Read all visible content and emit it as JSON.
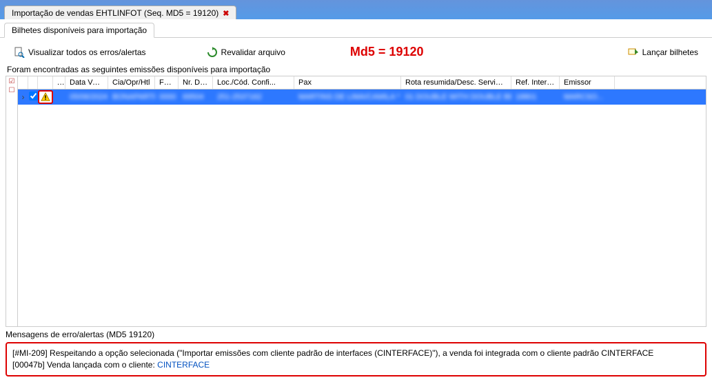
{
  "window": {
    "title": "Importação de vendas EHTLINFOT (Seq. MD5 = 19120)"
  },
  "tabs": {
    "main": "Bilhetes disponíveis para importação"
  },
  "toolbar": {
    "view_errors": "Visualizar todos os erros/alertas",
    "revalidate": "Revalidar arquivo",
    "md5_label": "Md5 = 19120",
    "launch": "Lançar bilhetes"
  },
  "section": {
    "found_label": "Foram encontradas as seguintes emissões disponíveis para importação"
  },
  "grid": {
    "headers": {
      "dots": "...",
      "data_venda": "Data Venda",
      "cia": "Cia/Opr/Htl",
      "form": "Form",
      "nr_doc": "Nr. Doc.",
      "loc": "Loc./Cód. Confi...",
      "pax": "Pax",
      "rota": "Rota resumida/Desc. Serviços",
      "ref": "Ref. Interf...",
      "emissor": "Emissor"
    },
    "row": {
      "checked": true,
      "data_venda": "05/06/2024",
      "cia": "BONAPARTE",
      "form": "0000",
      "nr_doc": "69504",
      "loc": "251-2537162",
      "pax": "MARTINS DE LIMA/CAMILA *",
      "rota": "01 DOUBLE WITH DOUBLE BE...",
      "ref": "18801",
      "emissor": "MARCSO..."
    }
  },
  "messages": {
    "panel_label": "Mensagens de erro/alertas (MD5 19120)",
    "body_pre": "[#MI-209] Respeitando a opção selecionada (\"Importar emissões com cliente padrão de interfaces (CINTERFACE)\"), a venda foi integrada com o cliente padrão CINTERFACE",
    "body_post": "[00047b] Venda lançada com o cliente: ",
    "link_text": "CINTERFACE"
  }
}
